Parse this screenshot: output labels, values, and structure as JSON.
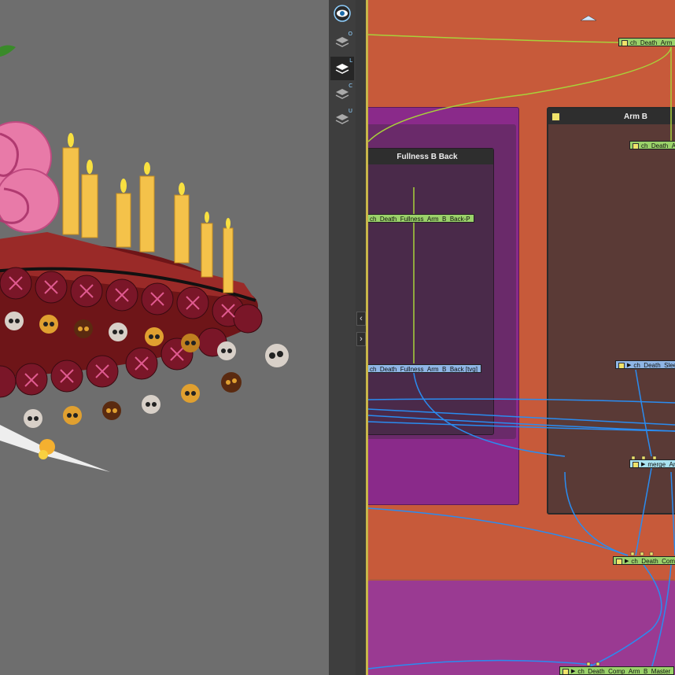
{
  "toolbar": {
    "tools": [
      {
        "name": "eye-icon",
        "letter": ""
      },
      {
        "name": "layers-icon",
        "letter": "O"
      },
      {
        "name": "layers-icon",
        "letter": "L"
      },
      {
        "name": "layers-icon",
        "letter": "C"
      },
      {
        "name": "layers-icon",
        "letter": "U"
      }
    ],
    "active_index": 2
  },
  "splitter": {
    "collapse_left": "‹",
    "collapse_right": "›"
  },
  "nodeview": {
    "groups": {
      "fullness": {
        "title": "Fullness B Back"
      },
      "arm": {
        "title": "Arm B"
      }
    },
    "nodes": {
      "death_arm_top": "ch_Death_Arm_",
      "death_a": "ch_Death_A",
      "fullness_peg": "ch_Death_Fullness_Arm_B_Back-P",
      "fullness_tvg": "ch_Death_Fullness_Arm_B_Back [tvg]",
      "sleeve": "ch_Death_Slee",
      "merge": "merge_Ar",
      "comp": "ch_Death_Com",
      "master": "ch_Death_Comp_Arm_B_Master"
    }
  },
  "colors": {
    "nodeview_bg": "#c75a3a",
    "group_purple": "#8a2a8a",
    "group_brown": "#5a3a36",
    "wire_green": "#a8d13a",
    "wire_blue": "#2a8cf0",
    "cake_red": "#8a1e22",
    "candle": "#f4c24a",
    "rose": "#e87aa8"
  }
}
